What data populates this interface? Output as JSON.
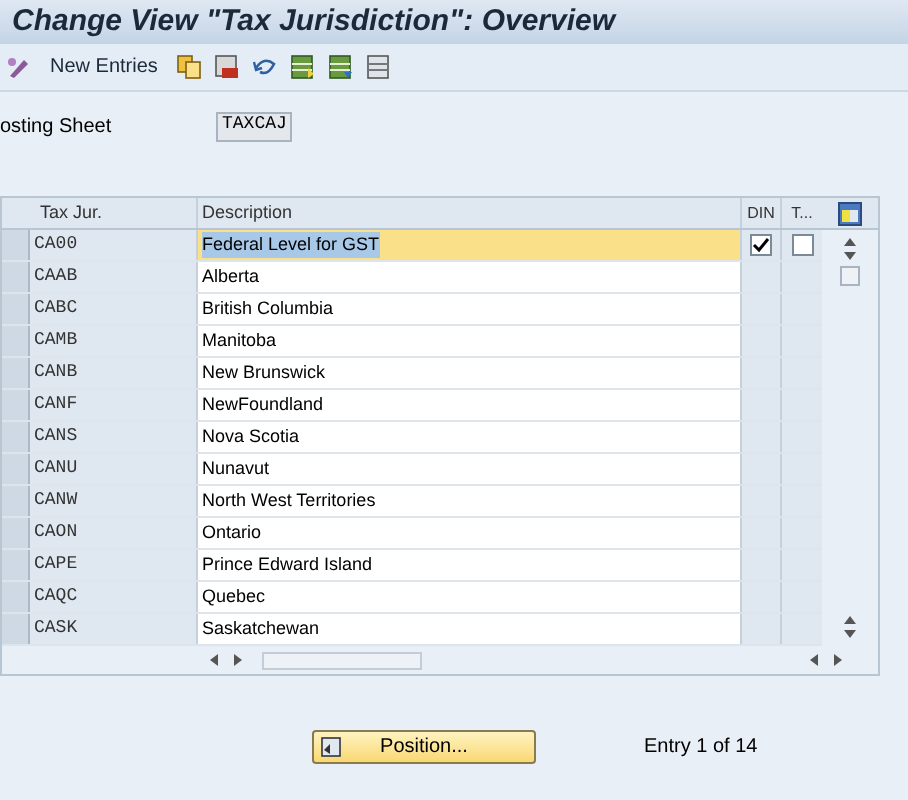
{
  "window": {
    "title": "Change View \"Tax Jurisdiction\": Overview"
  },
  "toolbar": {
    "new_entries": "New Entries"
  },
  "costing_sheet": {
    "label": "osting Sheet",
    "value": "TAXCAJ"
  },
  "table": {
    "columns": [
      "Tax Jur.",
      "Description",
      "DIN",
      "T..."
    ],
    "rows": [
      {
        "code": "CA00",
        "description": "Federal Level for GST",
        "selected": true,
        "kind": "checkboxes",
        "din_checked": true,
        "t_checked": false
      },
      {
        "code": "CAAB",
        "description": "Alberta",
        "selected": false,
        "kind": "plain"
      },
      {
        "code": "CABC",
        "description": "British Columbia",
        "selected": false,
        "kind": "plain"
      },
      {
        "code": "CAMB",
        "description": "Manitoba",
        "selected": false,
        "kind": "plain"
      },
      {
        "code": "CANB",
        "description": "New Brunswick",
        "selected": false,
        "kind": "plain"
      },
      {
        "code": "CANF",
        "description": "NewFoundland",
        "selected": false,
        "kind": "plain"
      },
      {
        "code": "CANS",
        "description": "Nova Scotia",
        "selected": false,
        "kind": "plain"
      },
      {
        "code": "CANU",
        "description": "Nunavut",
        "selected": false,
        "kind": "plain"
      },
      {
        "code": "CANW",
        "description": "North West Territories",
        "selected": false,
        "kind": "plain"
      },
      {
        "code": "CAON",
        "description": "Ontario",
        "selected": false,
        "kind": "plain"
      },
      {
        "code": "CAPE",
        "description": "Prince Edward Island",
        "selected": false,
        "kind": "plain"
      },
      {
        "code": "CAQC",
        "description": "Quebec",
        "selected": false,
        "kind": "plain"
      },
      {
        "code": "CASK",
        "description": "Saskatchewan",
        "selected": false,
        "kind": "plain"
      }
    ]
  },
  "footer": {
    "position_button": "Position...",
    "entry_count": "Entry 1 of 14"
  }
}
